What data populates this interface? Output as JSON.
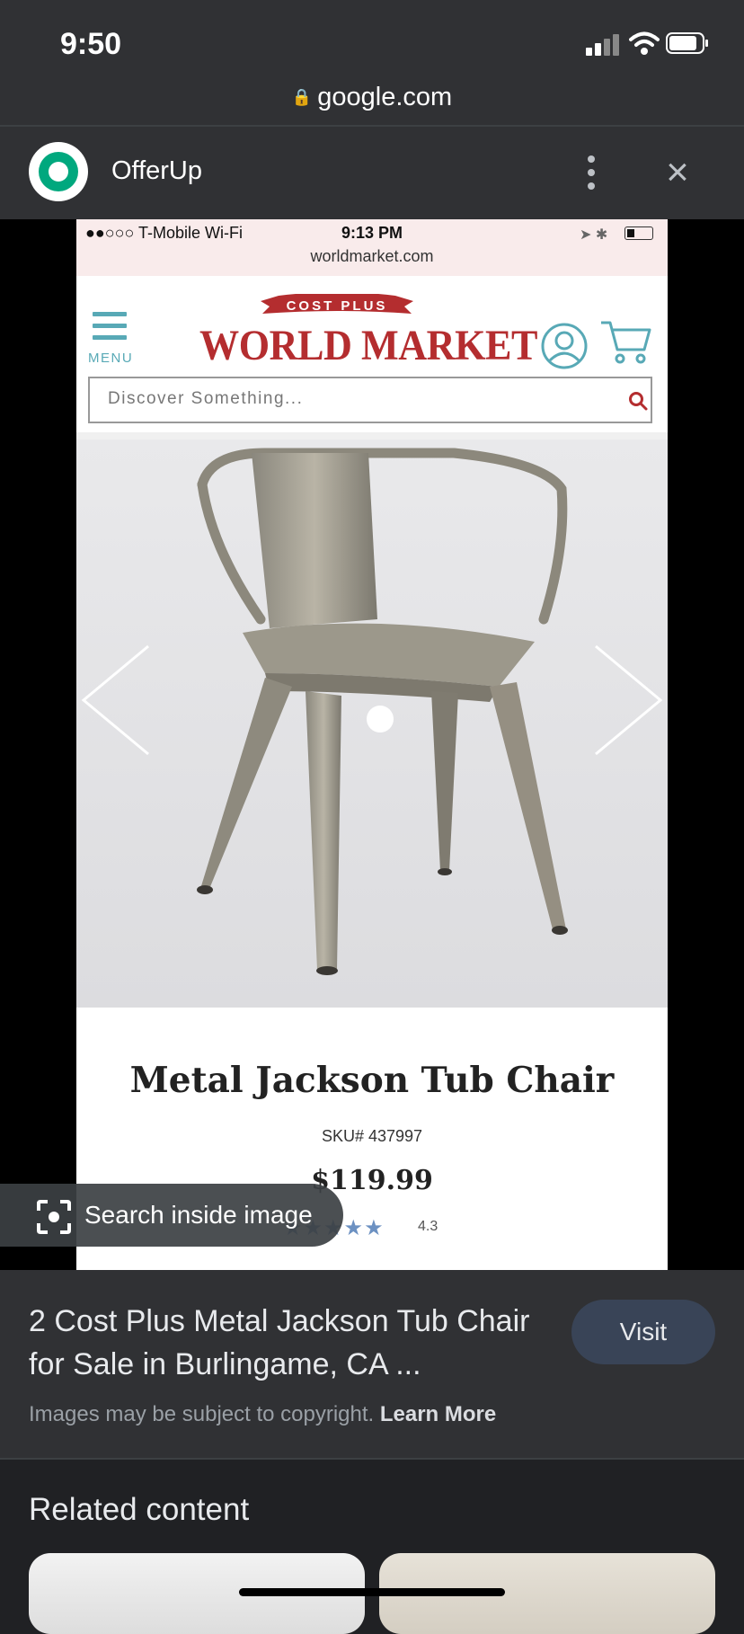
{
  "status_bar": {
    "time": "9:50",
    "url": "google.com"
  },
  "source": {
    "name": "OfferUp"
  },
  "screenshot": {
    "inner_status": {
      "carrier": "●●○○○ T-Mobile Wi-Fi",
      "time": "9:13 PM",
      "url": "worldmarket.com"
    },
    "site": {
      "menu_label": "MENU",
      "tagline": "COST PLUS",
      "logo": "WORLD MARKET",
      "search_placeholder": "Discover Something..."
    },
    "product": {
      "title": "Metal Jackson Tub Chair",
      "sku": "SKU# 437997",
      "price": "$119.99",
      "stars": "★★★★★",
      "rating": "4.3"
    }
  },
  "lens": {
    "label": "Search inside image"
  },
  "result": {
    "title": "2 Cost Plus Metal Jackson Tub Chair for Sale in Burlingame, CA ...",
    "visit_label": "Visit",
    "copyright_text": "Images may be subject to copyright.",
    "learn_more": "Learn More"
  },
  "related": {
    "heading": "Related content"
  },
  "colors": {
    "brand_red": "#b42d2f",
    "teal": "#58a9b6",
    "offerup_green": "#00a87e",
    "visit_bg": "#394457"
  }
}
